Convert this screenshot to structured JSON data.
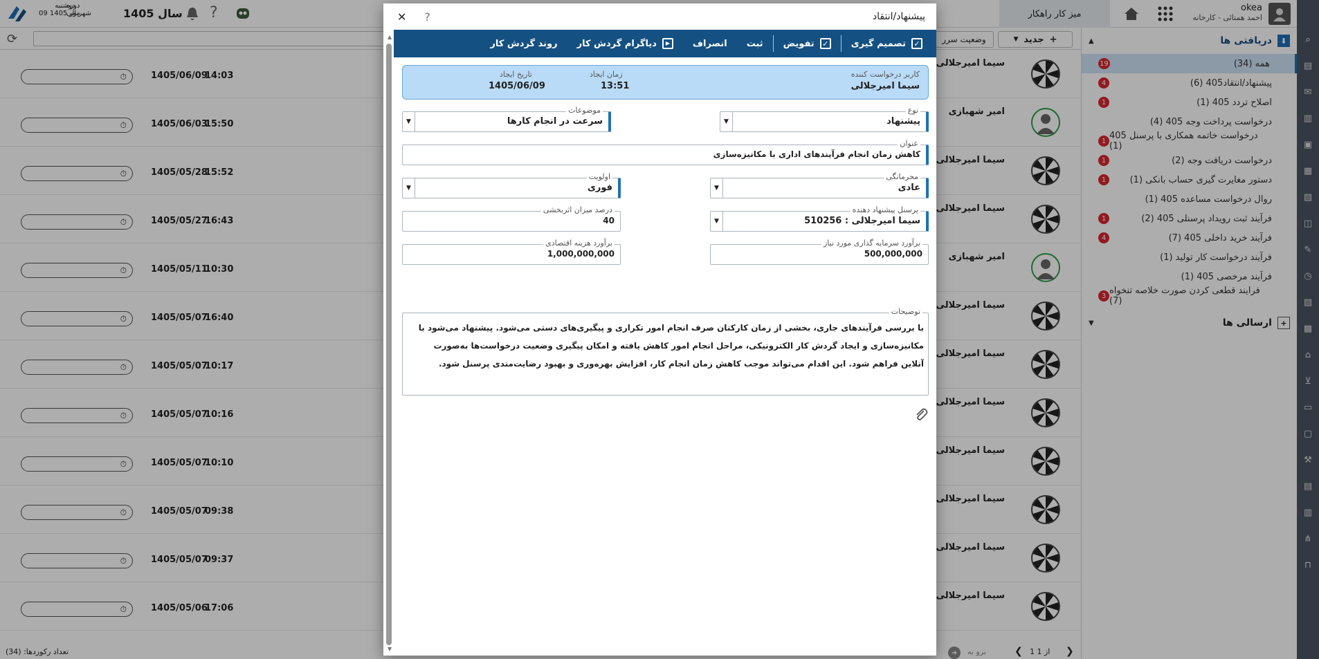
{
  "topbar": {
    "user_name": "okea",
    "user_sub": "احمد همتائی - کارخانه",
    "workspace": "میز کار راهکار",
    "year_label": "سال 1405",
    "period_label_1": "دوره",
    "period_label_2": "مالی",
    "weekday": "دوشنبه",
    "date": "09 شهریور 1405"
  },
  "toolbar": {
    "new_label": "جدید",
    "status_label": "وضعیت سرر"
  },
  "sidebar": {
    "inbox_title": "دریافتی ها",
    "outbox_title": "ارسالی ها",
    "items": [
      {
        "label": "همه (34)",
        "badge": "19"
      },
      {
        "label": "پیشنهاد/انتقاد405 (6)",
        "badge": "4"
      },
      {
        "label": "اصلاح تردد 405 (1)",
        "badge": "1"
      },
      {
        "label": "درخواست پرداخت وجه 405 (4)",
        "badge": ""
      },
      {
        "label": "درخواست خاتمه همکاری با پرسنل 405 (1)",
        "badge": "1"
      },
      {
        "label": "درخواست دریافت وجه (2)",
        "badge": "1"
      },
      {
        "label": "دستور مغایرت گیری حساب بانکی (1)",
        "badge": "1"
      },
      {
        "label": "روال درخواست مساعده 405 (1)",
        "badge": ""
      },
      {
        "label": "فرآیند ثبت رویداد پرسنلی 405 (2)",
        "badge": "1"
      },
      {
        "label": "فرآیند خرید داخلی 405 (7)",
        "badge": "4"
      },
      {
        "label": "فرآیند درخواست کار تولید (1)",
        "badge": ""
      },
      {
        "label": "فرآیند مرخصی 405 (1)",
        "badge": ""
      },
      {
        "label": "فرایند قطعی کردن صورت خلاصه تنخواه (7)",
        "badge": "3"
      }
    ]
  },
  "list": {
    "rows": [
      {
        "name": "سیما امیرجلالی",
        "date": "1405/06/09",
        "time": "14:03",
        "green": false
      },
      {
        "name": "امیر شهبازی",
        "date": "1405/06/03",
        "time": "15:50",
        "green": true
      },
      {
        "name": "سیما امیرجلالی",
        "date": "1405/05/28",
        "time": "15:52",
        "green": false
      },
      {
        "name": "سیما امیرجلالی",
        "date": "1405/05/27",
        "time": "16:43",
        "green": false
      },
      {
        "name": "امیر شهبازی",
        "date": "1405/05/11",
        "time": "10:30",
        "green": true
      },
      {
        "name": "سیما امیرجلالی",
        "date": "1405/05/07",
        "time": "16:40",
        "green": false
      },
      {
        "name": "سیما امیرجلالی",
        "date": "1405/05/07",
        "time": "10:17",
        "green": false
      },
      {
        "name": "سیما امیرجلالی",
        "date": "1405/05/07",
        "time": "10:16",
        "green": false
      },
      {
        "name": "سیما امیرجلالی",
        "date": "1405/05/07",
        "time": "10:10",
        "green": false
      },
      {
        "name": "سیما امیرجلالی",
        "date": "1405/05/07",
        "time": "09:38",
        "green": false
      },
      {
        "name": "سیما امیرجلالی",
        "date": "1405/05/07",
        "time": "09:37",
        "green": false
      },
      {
        "name": "سیما امیرجلالی",
        "date": "1405/05/06",
        "time": "17:06",
        "green": false
      }
    ],
    "record_count": "تعداد رکوردها: (34)",
    "pager_go": "برو به",
    "pager_text": "1 از 1"
  },
  "dialog": {
    "title": "پیشنهاد/انتقاد",
    "toolbar": {
      "decide": "تصمیم گیری",
      "delegate": "تفویض",
      "save": "ثبت",
      "cancel": "انصراف",
      "diagram": "دیاگرام گردش کار",
      "process": "روند گردش کار"
    },
    "info": {
      "requester_label": "کاربر درخواست کننده",
      "requester": "سیما امیرجلالی",
      "created_time_label": "زمان ایجاد",
      "created_time": "13:51",
      "created_date_label": "تاریخ ایجاد",
      "created_date": "1405/06/09"
    },
    "fields": {
      "type_label": "نوع",
      "type": "پیشنهاد",
      "topics_label": "موضوعات",
      "topics": "سرعت در انجام کارها",
      "subject_label": "عنوان",
      "subject": "کاهش زمان انجام فرآیندهای اداری با مکانیزه‌سازی",
      "confidentiality_label": "محرمانگی",
      "confidentiality": "عادی",
      "priority_label": "اولویت",
      "priority": "فوری",
      "proposer_label": "پرسنل پیشنهاد دهنده",
      "proposer": "510256 : سیما امیرجلالی",
      "effectiveness_label": "درصد میزان اثربخشی",
      "effectiveness": "40",
      "investment_label": "برآورد سرمایه گذاری مورد نیاز",
      "investment": "500,000,000",
      "cost_label": "برآورد هزینه اقتصادی",
      "cost": "1,000,000,000",
      "description_label": "توضیحات",
      "description": "با بررسی فرآیندهای جاری، بخشی از زمان کارکنان صرف انجام امور تکراری و پیگیری‌های دستی می‌شود. پیشنهاد می‌شود با مکانیزه‌سازی و ایجاد گردش کار الکترونیکی، مراحل انجام امور کاهش یافته و امکان پیگیری وضعیت درخواست‌ها به‌صورت آنلاین فراهم شود. این اقدام می‌تواند موجب کاهش زمان انجام کار، افزایش بهره‌وری و بهبود رضایت‌مندی پرسنل شود."
    }
  }
}
